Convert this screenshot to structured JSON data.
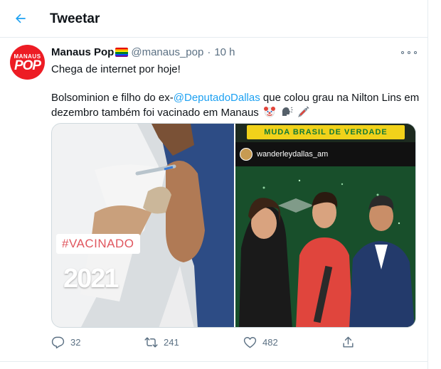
{
  "header": {
    "title": "Tweetar"
  },
  "tweet": {
    "author_name": "Manaus Pop",
    "handle": "@manaus_pop",
    "separator": "·",
    "time": "10 h",
    "avatar": {
      "line1": "MANAUS",
      "line2": "POP"
    },
    "text": {
      "line1": "Chega de internet por hoje!",
      "part1": "Bolsominion e filho do ex-",
      "mention": "@DeputadoDallas",
      "part2": " que colou grau na Nilton Lins em dezembro também foi vacinado em Manaus"
    },
    "media": {
      "left": {
        "tag": "#VACINADO",
        "year": "2021"
      },
      "right": {
        "banner": "MUDA BRASIL DE VERDADE",
        "story_user": "wanderleydallas_am"
      }
    },
    "counts": {
      "replies": "32",
      "retweets": "241",
      "likes": "482"
    }
  },
  "colors": {
    "accent": "#1da1f2",
    "secondary_text": "#5b7083",
    "border": "#e6ecf0",
    "avatar_bg": "#ed1c24"
  },
  "icons": [
    "back-arrow-icon",
    "rainbow-flag-icon",
    "more-icon",
    "clown-emoji-icon",
    "speaking-head-emoji-icon",
    "syringe-emoji-icon",
    "reply-icon",
    "retweet-icon",
    "like-icon",
    "share-icon"
  ]
}
